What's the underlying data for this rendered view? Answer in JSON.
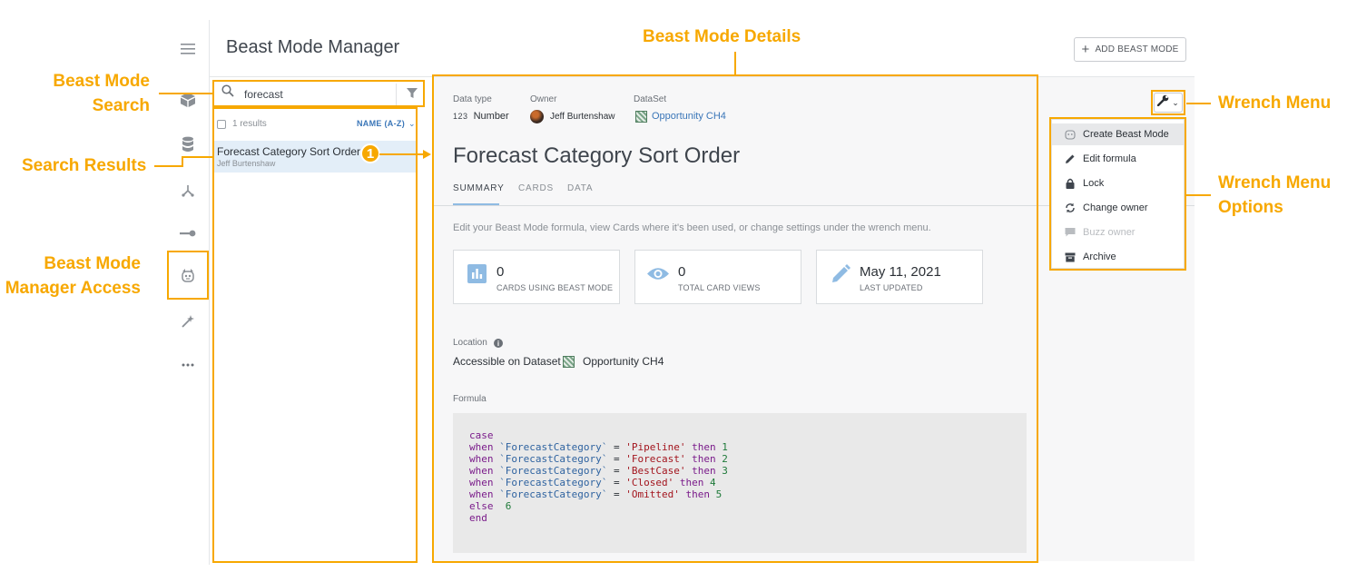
{
  "app": {
    "title": "Beast Mode Manager",
    "add_button": "ADD BEAST MODE"
  },
  "annotations": {
    "details": "Beast Mode Details",
    "search_line1": "Beast Mode",
    "search_line2": "Search",
    "results": "Search Results",
    "access_line1": "Beast Mode",
    "access_line2": "Manager Access",
    "wrench": "Wrench Menu",
    "wrench_opts_line1": "Wrench Menu",
    "wrench_opts_line2": "Options",
    "badge": "1"
  },
  "search": {
    "value": "forecast",
    "results_count": "1 results",
    "sort_label": "NAME (A-Z)",
    "results": [
      {
        "title": "Forecast Category Sort Order",
        "owner": "Jeff Burtenshaw"
      }
    ]
  },
  "details": {
    "meta": {
      "data_type_label": "Data type",
      "data_type_icon": "123",
      "data_type_value": "Number",
      "owner_label": "Owner",
      "owner_value": "Jeff Burtenshaw",
      "dataset_label": "DataSet",
      "dataset_value": "Opportunity CH4"
    },
    "title": "Forecast Category Sort Order",
    "tabs": [
      "SUMMARY",
      "CARDS",
      "DATA"
    ],
    "description": "Edit your Beast Mode formula, view Cards where it's been used, or change settings under the wrench menu.",
    "stats": [
      {
        "value": "0",
        "label": "CARDS USING BEAST MODE",
        "icon": "bar-chart-icon"
      },
      {
        "value": "0",
        "label": "TOTAL CARD VIEWS",
        "icon": "eye-icon"
      },
      {
        "value": "May 11, 2021",
        "label": "LAST UPDATED",
        "icon": "pencil-icon"
      }
    ],
    "location_label": "Location",
    "location_prefix": "Accessible on Dataset",
    "location_dataset": "Opportunity CH4",
    "formula_label": "Formula",
    "formula": {
      "case_kw": "case",
      "when_kw": "when",
      "then_kw": "then",
      "else_kw": "else",
      "end_kw": "end",
      "field": "`ForecastCategory`",
      "equals": "=",
      "rows": [
        {
          "value": "'Pipeline'",
          "result": "1"
        },
        {
          "value": "'Forecast'",
          "result": "2"
        },
        {
          "value": "'BestCase'",
          "result": "3"
        },
        {
          "value": "'Closed'",
          "result": "4"
        },
        {
          "value": "'Omitted'",
          "result": "5"
        }
      ],
      "else_value": "6"
    }
  },
  "wrench_menu": {
    "items": [
      {
        "label": "Create Beast Mode",
        "icon": "beast-mode-icon",
        "state": "highlighted"
      },
      {
        "label": "Edit formula",
        "icon": "pencil-icon",
        "state": "normal"
      },
      {
        "label": "Lock",
        "icon": "lock-icon",
        "state": "normal"
      },
      {
        "label": "Change owner",
        "icon": "refresh-icon",
        "state": "normal"
      },
      {
        "label": "Buzz owner",
        "icon": "chat-icon",
        "state": "disabled"
      },
      {
        "label": "Archive",
        "icon": "archive-icon",
        "state": "normal"
      }
    ]
  },
  "colors": {
    "annotation": "#f7a800",
    "link": "#3a76b8",
    "selected_row": "#e3eef8"
  }
}
